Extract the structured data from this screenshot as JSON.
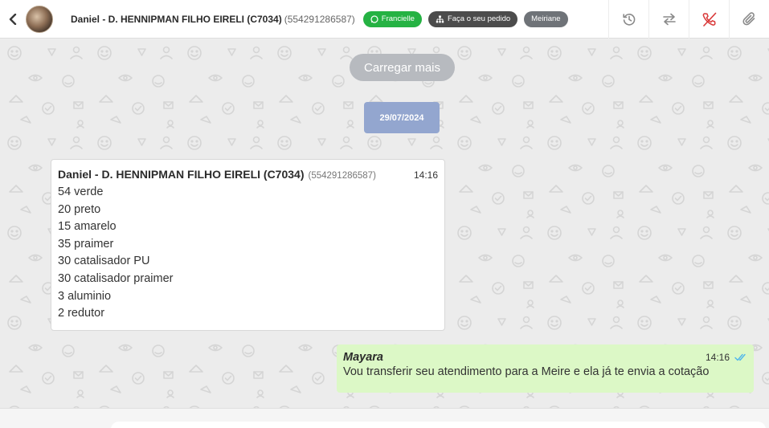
{
  "header": {
    "contact_name": "Daniel - D. HENNIPMAN FILHO EIRELI (C7034)",
    "contact_phone": "(554291286587)",
    "tags": [
      {
        "label": "Francielle",
        "icon": "whatsapp-icon",
        "color": "#25b243"
      },
      {
        "label": "Faça o seu pedido",
        "icon": "org-tree-icon",
        "color": "#4c4c4c"
      },
      {
        "label": "Meiriane",
        "color": "#6f7378"
      }
    ],
    "actions": [
      "history-icon",
      "transfer-icon",
      "end-call-icon",
      "attach-icon"
    ]
  },
  "chat": {
    "load_more_label": "Carregar mais",
    "date": "29/07/2024",
    "incoming": {
      "sender": "Daniel - D. HENNIPMAN FILHO EIRELI (C7034)",
      "phone": "(554291286587)",
      "time": "14:16",
      "lines": [
        "54 verde",
        "20 preto",
        "15 amarelo",
        "35 praimer",
        "30 catalisador PU",
        "30 catalisador praimer",
        "3 aluminio",
        "2 redutor"
      ]
    },
    "outgoing": {
      "sender": "Mayara",
      "time": "14:16",
      "text": "Vou transferir seu atendimento para a Meire e ela já te envia a cotação",
      "status": "read"
    }
  },
  "colors": {
    "accent_green": "#25b243",
    "date_chip": "#93a6cf",
    "outgoing_bubble": "#dcf8c6",
    "read_ticks": "#4fb6ec",
    "end_call": "#d93a3a"
  }
}
